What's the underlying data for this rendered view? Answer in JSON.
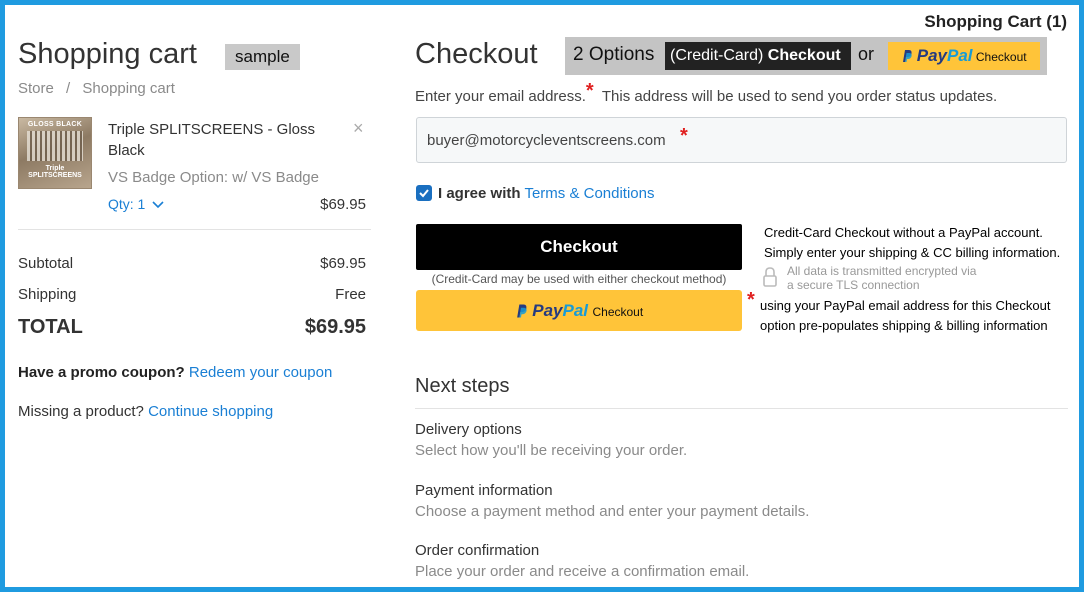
{
  "header": {
    "cart_count_label": "Shopping Cart (1)"
  },
  "cart": {
    "title": "Shopping cart",
    "sample_badge": "sample",
    "breadcrumb": [
      "Store",
      "/",
      "Shopping cart"
    ],
    "item": {
      "thumb_top": "GLOSS BLACK",
      "thumb_bottom": "Triple SPLITSCREENS",
      "name": "Triple SPLITSCREENS - Gloss Black",
      "option": "VS Badge Option: w/ VS Badge",
      "qty_label": "Qty: 1",
      "price": "$69.95",
      "remove_glyph": "×"
    },
    "subtotal_label": "Subtotal",
    "subtotal_value": "$69.95",
    "shipping_label": "Shipping",
    "shipping_value": "Free",
    "total_label": "TOTAL",
    "total_value": "$69.95",
    "promo_text": "Have a promo coupon?",
    "promo_link": "Redeem your coupon",
    "missing_text": "Missing a product?",
    "missing_link": "Continue shopping"
  },
  "checkout": {
    "title": "Checkout",
    "options_banner": {
      "count": "2 Options",
      "cc_part1": "(Credit-Card)",
      "cc_part2": "Checkout",
      "or": "or",
      "paypal_p1": "Pay",
      "paypal_p2": "Pal",
      "paypal_checkout": "Checkout"
    },
    "email_prompt": "Enter your email address.",
    "required_star": "*",
    "email_hint": "This address will be used to send you order status updates.",
    "email_value": "buyer@motorcycleventscreens.com",
    "agree_text": "I agree with",
    "terms_link": "Terms & Conditions",
    "checkout_button": "Checkout",
    "cc_note": "(Credit-Card may be used with either checkout method)",
    "paypal_button_p1": "Pay",
    "paypal_button_p2": "Pal",
    "paypal_button_checkout": "Checkout",
    "cc_info_line1": "Credit-Card Checkout without a PayPal account.",
    "cc_info_line2": "Simply enter your shipping & CC billing information.",
    "tls_line1": "All data is transmitted encrypted via",
    "tls_line2": "a secure TLS connection",
    "paypal_info_line1": "using your PayPal email address for this Checkout",
    "paypal_info_line2": "option pre-populates shipping & billing information",
    "next_steps_title": "Next steps",
    "steps": [
      {
        "title": "Delivery options",
        "desc": "Select how you'll be receiving your order."
      },
      {
        "title": "Payment information",
        "desc": "Choose a payment method and enter your payment details."
      },
      {
        "title": "Order confirmation",
        "desc": "Place your order and receive a confirmation email."
      }
    ]
  },
  "colors": {
    "border": "#1f9be0",
    "link": "#1a7fd4",
    "paypal": "#ffc439",
    "star": "#e02020"
  }
}
